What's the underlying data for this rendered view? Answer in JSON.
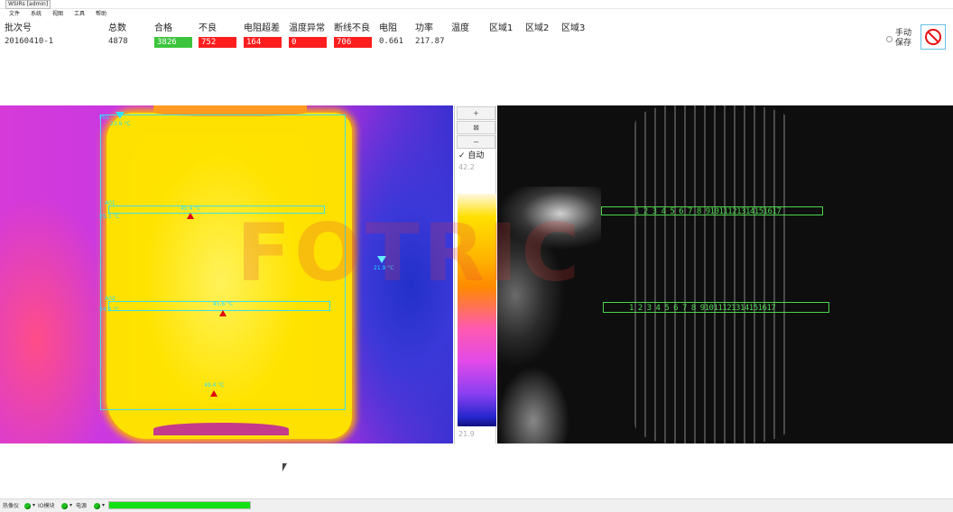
{
  "window": {
    "title": "WSIRs [admin]"
  },
  "menu": [
    "文件",
    "系统",
    "视图",
    "工具",
    "帮助"
  ],
  "header": {
    "batch_label": "批次号",
    "batch_value": "20160410-1",
    "total_label": "总数",
    "total_value": "4878",
    "pass_label": "合格",
    "pass_value": "3826",
    "fail_label": "不良",
    "fail_value": "752",
    "res_over_label": "电阻超差",
    "res_over_value": "164",
    "temp_abn_label": "温度异常",
    "temp_abn_value": "0",
    "break_label": "断线不良",
    "break_value": "706",
    "resistance_label": "电阻",
    "resistance_value": "0.661",
    "power_label": "功率",
    "power_value": "217.87",
    "temp_label": "温度",
    "zone1_label": "区域1",
    "zone2_label": "区域2",
    "zone3_label": "区域3",
    "manual_save_label": "手动保存"
  },
  "thermal": {
    "labels": {
      "p01": "Po1",
      "p01_temp": "23.6 °C",
      "a01": "A01",
      "a01_temp": "25.3 °C",
      "a02": "A02",
      "a02_temp": "24.3 °C",
      "hot1": "45.4 °C",
      "hot2": "45.6 °C",
      "hot3": "49.4 °C",
      "cold": "21.9 °C"
    },
    "watermark": "FOTRIC"
  },
  "palette": {
    "up_btn": "+",
    "mid_btn": "⊠",
    "down_btn": "−",
    "auto_label": "自动",
    "max_temp": "42.2",
    "min_temp": "21.9"
  },
  "visible": {
    "roi1_numbers": "1 2 3 4 5 6 7 8 91011121314151617",
    "roi2_numbers": "1 2 3 4 5 6 7 8 91011121314151617"
  },
  "status": {
    "thermal_cam": "热像仪",
    "io_module": "IO模块",
    "power_supply": "电源",
    "colors": {
      "ok": "#20c020",
      "progress": "#12e012"
    },
    "progress_fraction": 1.0
  }
}
